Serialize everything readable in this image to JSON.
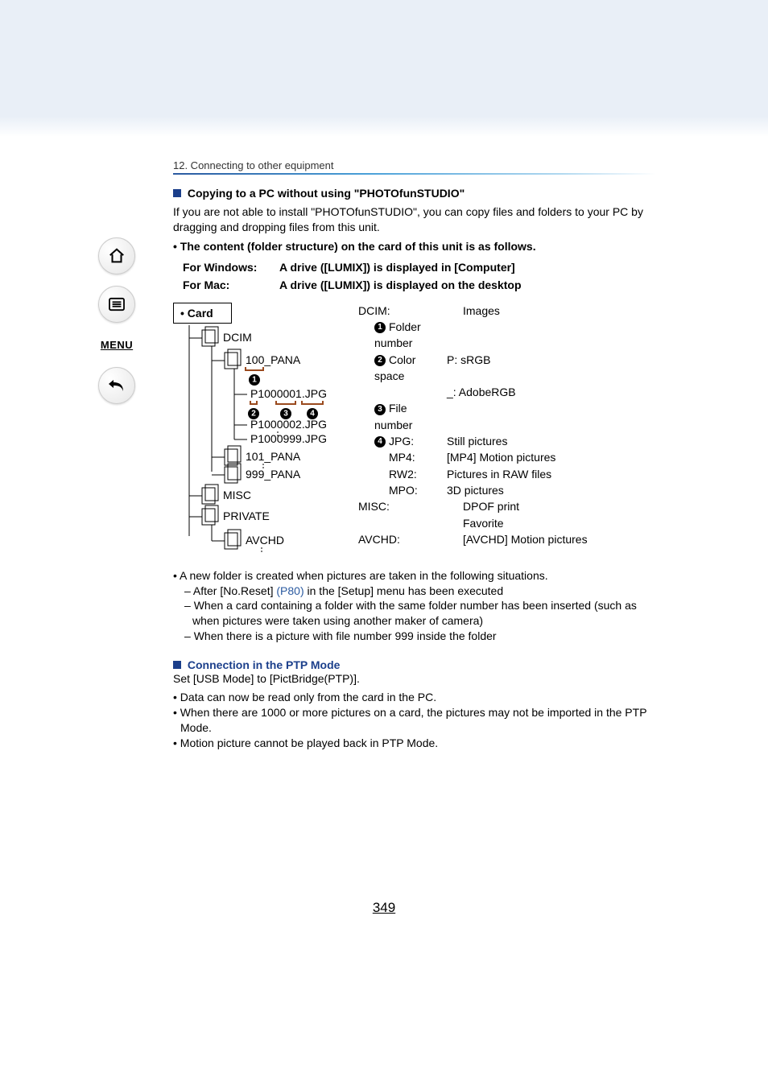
{
  "breadcrumb": "12. Connecting to other equipment",
  "sidebar": {
    "home": "home-icon",
    "toc": "toc-icon",
    "menu_label": "MENU",
    "back": "back-icon"
  },
  "section1": {
    "title": "Copying to a PC without using \"PHOTOfunSTUDIO\"",
    "para": "If you are not able to install \"PHOTOfunSTUDIO\", you can copy files and folders to your PC by dragging and dropping files from this unit.",
    "bullet_strong": "The content (folder structure) on the card of this unit is as follows.",
    "os": [
      {
        "label": "For Windows:",
        "desc": "A drive ([LUMIX]) is displayed in [Computer]"
      },
      {
        "label": "For Mac:",
        "desc": "A drive ([LUMIX]) is displayed on the desktop"
      }
    ]
  },
  "card_label": "• Card",
  "tree": {
    "dcim": "DCIM",
    "f100": "100_PANA",
    "p1": "P1000001.JPG",
    "p2": "P1000002.JPG",
    "p999": "P1000999.JPG",
    "f101": "101_PANA",
    "f999": "999_PANA",
    "misc": "MISC",
    "private": "PRIVATE",
    "avchd": "AVCHD",
    "callouts": {
      "n1": "1",
      "n2": "2",
      "n3": "3",
      "n4": "4"
    }
  },
  "legend": {
    "dcim_k": "DCIM:",
    "dcim_v": "Images",
    "r1": {
      "n": "1",
      "k": "Folder number",
      "v": ""
    },
    "r2": {
      "n": "2",
      "k": "Color space",
      "v1": "P: sRGB",
      "v2": "_: AdobeRGB"
    },
    "r3": {
      "n": "3",
      "k": "File number",
      "v": ""
    },
    "r4": {
      "n": "4",
      "k": "JPG:",
      "v": "Still pictures"
    },
    "mp4_k": "MP4:",
    "mp4_v": "[MP4] Motion pictures",
    "rw2_k": "RW2:",
    "rw2_v": "Pictures in RAW files",
    "mpo_k": "MPO:",
    "mpo_v": "3D pictures",
    "misc_k": "MISC:",
    "misc_v1": "DPOF print",
    "misc_v2": "Favorite",
    "avchd_k": "AVCHD:",
    "avchd_v": "[AVCHD] Motion pictures"
  },
  "notes": {
    "b1": "A new folder is created when pictures are taken in the following situations.",
    "s1a": "After [No.Reset] ",
    "s1_link": "(P80)",
    "s1b": " in the [Setup] menu has been executed",
    "s2": "When a card containing a folder with the same folder number has been inserted (such as when pictures were taken using another maker of camera)",
    "s3": "When there is a picture with file number 999 inside the folder"
  },
  "section2": {
    "title": "Connection in the PTP Mode",
    "para": "Set [USB Mode] to [PictBridge(PTP)].",
    "b1": "Data can now be read only from the card in the PC.",
    "b2": "When there are 1000 or more pictures on a card, the pictures may not be imported in the PTP Mode.",
    "b3": "Motion picture cannot be played back in PTP Mode."
  },
  "page_number": "349"
}
